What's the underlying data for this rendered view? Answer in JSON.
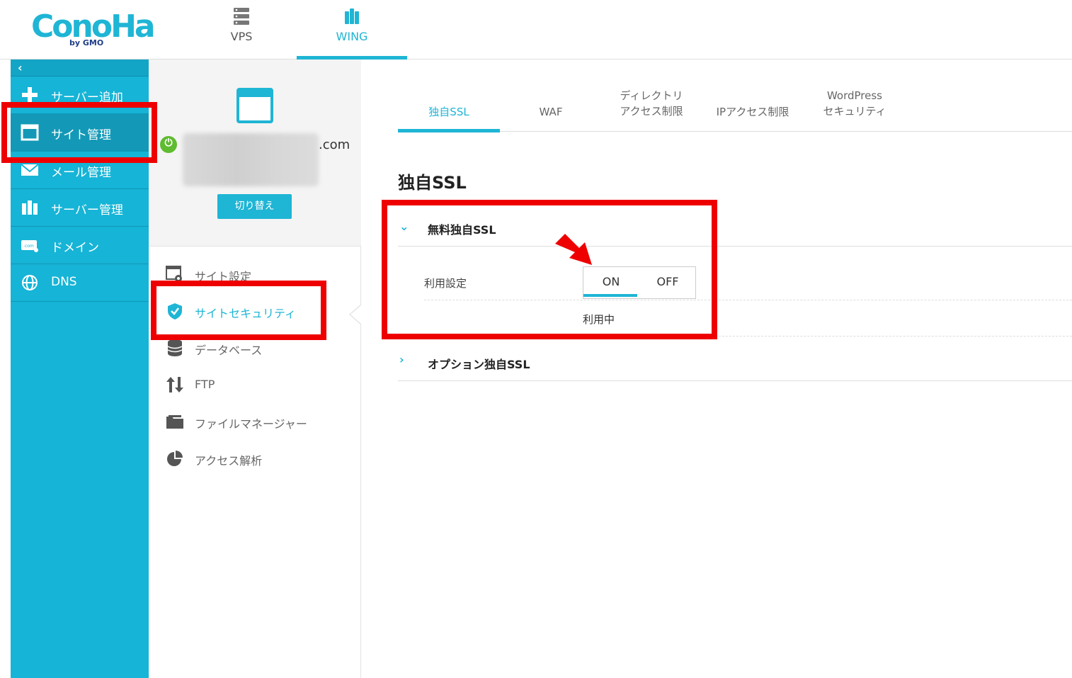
{
  "header": {
    "logo_text": "ConoHa",
    "logo_by": "by GMO",
    "tabs": [
      {
        "label": "VPS",
        "icon": "server-icon",
        "active": false
      },
      {
        "label": "WING",
        "icon": "wing-server-icon",
        "active": true
      }
    ]
  },
  "sidebar": {
    "collapse_icon": "chevron-left-icon",
    "items": [
      {
        "label": "サーバー追加",
        "icon": "plus-icon"
      },
      {
        "label": "サイト管理",
        "icon": "window-icon",
        "active": true
      },
      {
        "label": "メール管理",
        "icon": "mail-icon"
      },
      {
        "label": "サーバー管理",
        "icon": "server-manage-icon"
      },
      {
        "label": "ドメイン",
        "icon": "domain-icon"
      },
      {
        "label": "DNS",
        "icon": "globe-icon"
      }
    ]
  },
  "site_card": {
    "domain_suffix": ".com",
    "switch_label": "切り替え",
    "status_color": "#5fbb2f"
  },
  "site_menu": {
    "items": [
      {
        "label": "サイト設定",
        "icon": "site-settings-icon"
      },
      {
        "label": "サイトセキュリティ",
        "icon": "shield-check-icon",
        "active": true
      },
      {
        "label": "データベース",
        "icon": "database-icon"
      },
      {
        "label": "FTP",
        "icon": "transfer-arrows-icon"
      },
      {
        "label": "ファイルマネージャー",
        "icon": "folder-icon"
      },
      {
        "label": "アクセス解析",
        "icon": "pie-chart-icon"
      }
    ]
  },
  "content_tabs": [
    {
      "line1": "独自SSL",
      "line2": "",
      "active": true
    },
    {
      "line1": "WAF",
      "line2": ""
    },
    {
      "line1": "ディレクトリ",
      "line2": "アクセス制限"
    },
    {
      "line1": "IPアクセス制限",
      "line2": ""
    },
    {
      "line1": "WordPress",
      "line2": "セキュリティ"
    }
  ],
  "section_title": "独自SSL",
  "free_ssl": {
    "title": "無料独自SSL",
    "usage_label": "利用設定",
    "on_label": "ON",
    "off_label": "OFF",
    "selected": "ON",
    "status": "利用中"
  },
  "option_ssl": {
    "title": "オプション独自SSL"
  },
  "colors": {
    "accent": "#1fb5d5",
    "sidebar": "#16b4d6",
    "annotation": "#ee0000"
  }
}
